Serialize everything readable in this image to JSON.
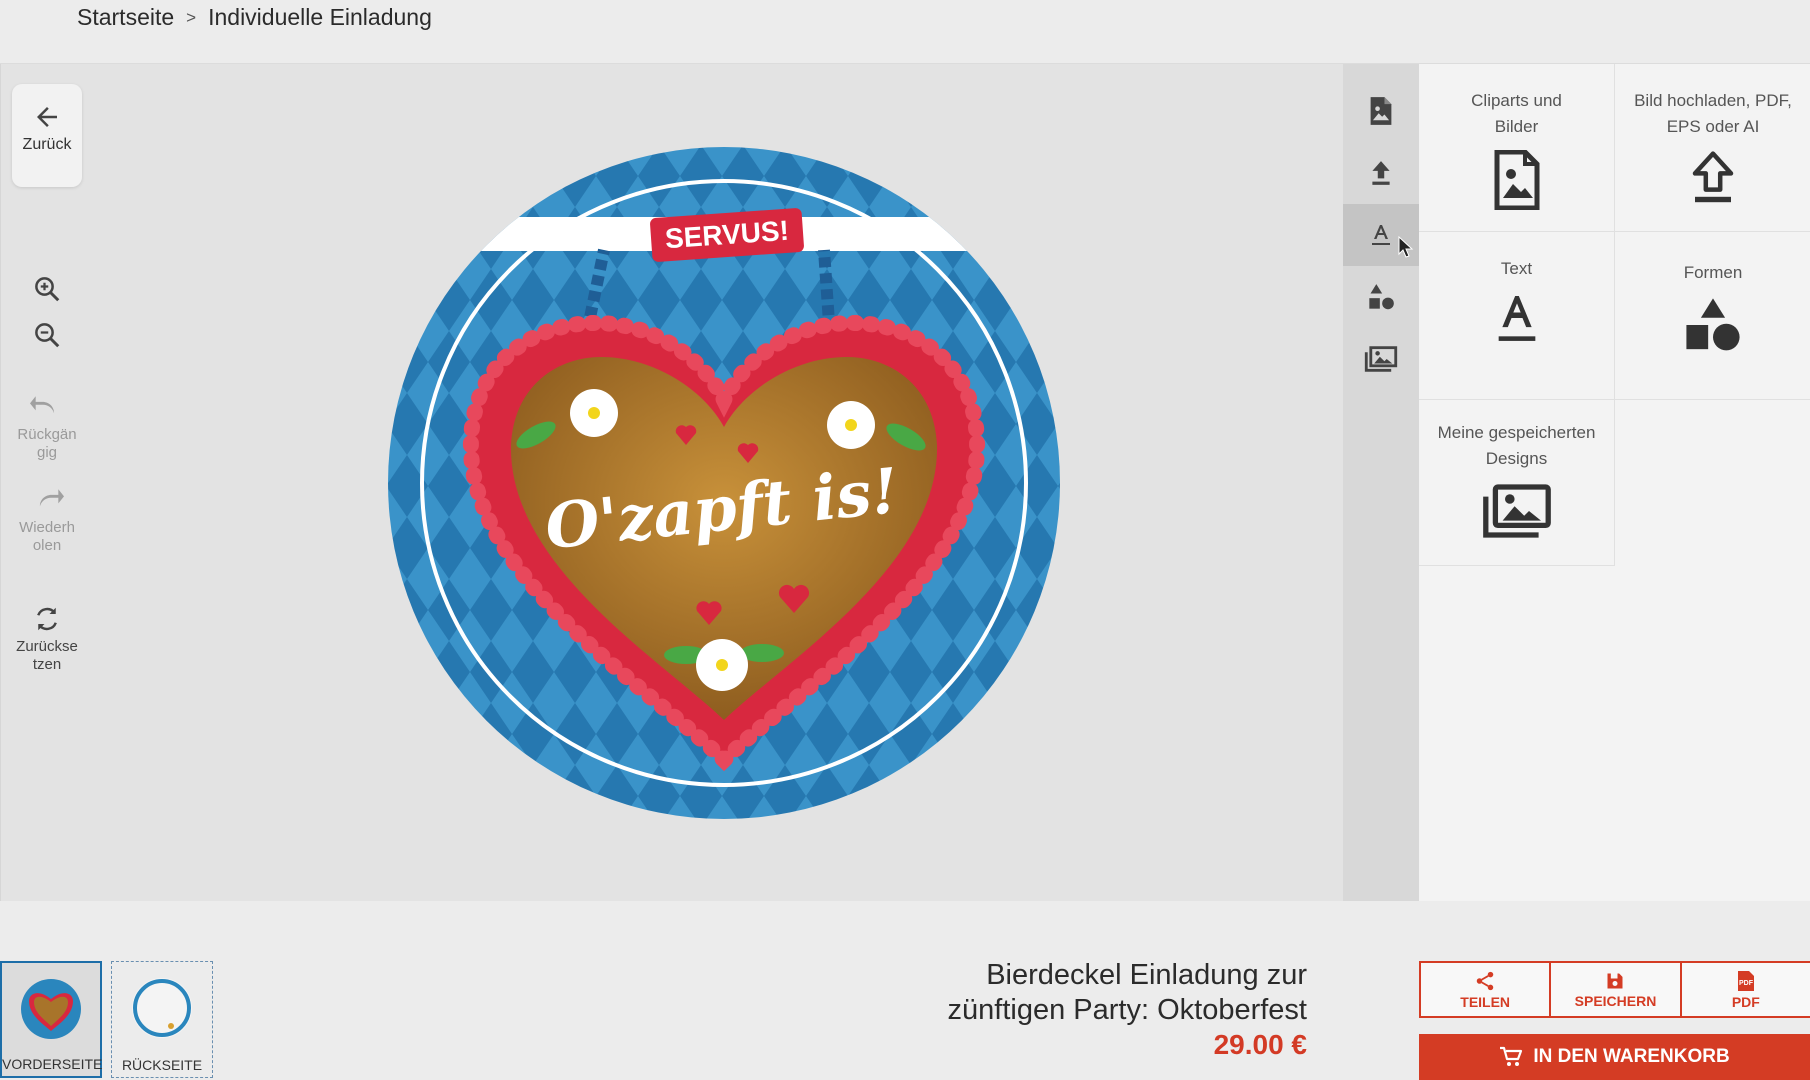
{
  "breadcrumb": {
    "home": "Startseite",
    "current": "Individuelle Einladung"
  },
  "tools": {
    "back": "Zurück",
    "undo": [
      "Rückgän",
      "gig"
    ],
    "redo": [
      "Wiederh",
      "olen"
    ],
    "reset": [
      "Zurückse",
      "tzen"
    ]
  },
  "design": {
    "banner": "SERVUS!",
    "heart_text": "O'zapft is!"
  },
  "panel": {
    "cliparts": [
      "Cliparts und",
      "Bilder"
    ],
    "upload": [
      "Bild hochladen, PDF,",
      "EPS oder AI"
    ],
    "text": "Text",
    "shapes": "Formen",
    "saved": [
      "Meine gespeicherten",
      "Designs"
    ]
  },
  "pages": {
    "front": "VORDERSEITE",
    "back": "RÜCKSEITE"
  },
  "product": {
    "name_line1": "Bierdeckel Einladung zur",
    "name_line2": "zünftigen Party: Oktoberfest",
    "price": "29.00 €"
  },
  "actions": {
    "share": "TEILEN",
    "save": "SPEICHERN",
    "pdf": "PDF",
    "cart": "IN DEN WARENKORB"
  },
  "colors": {
    "accent": "#d43c24",
    "blue": "#2a86bd",
    "heart_red": "#d8283f",
    "gingerbread": "#b07a2c"
  }
}
